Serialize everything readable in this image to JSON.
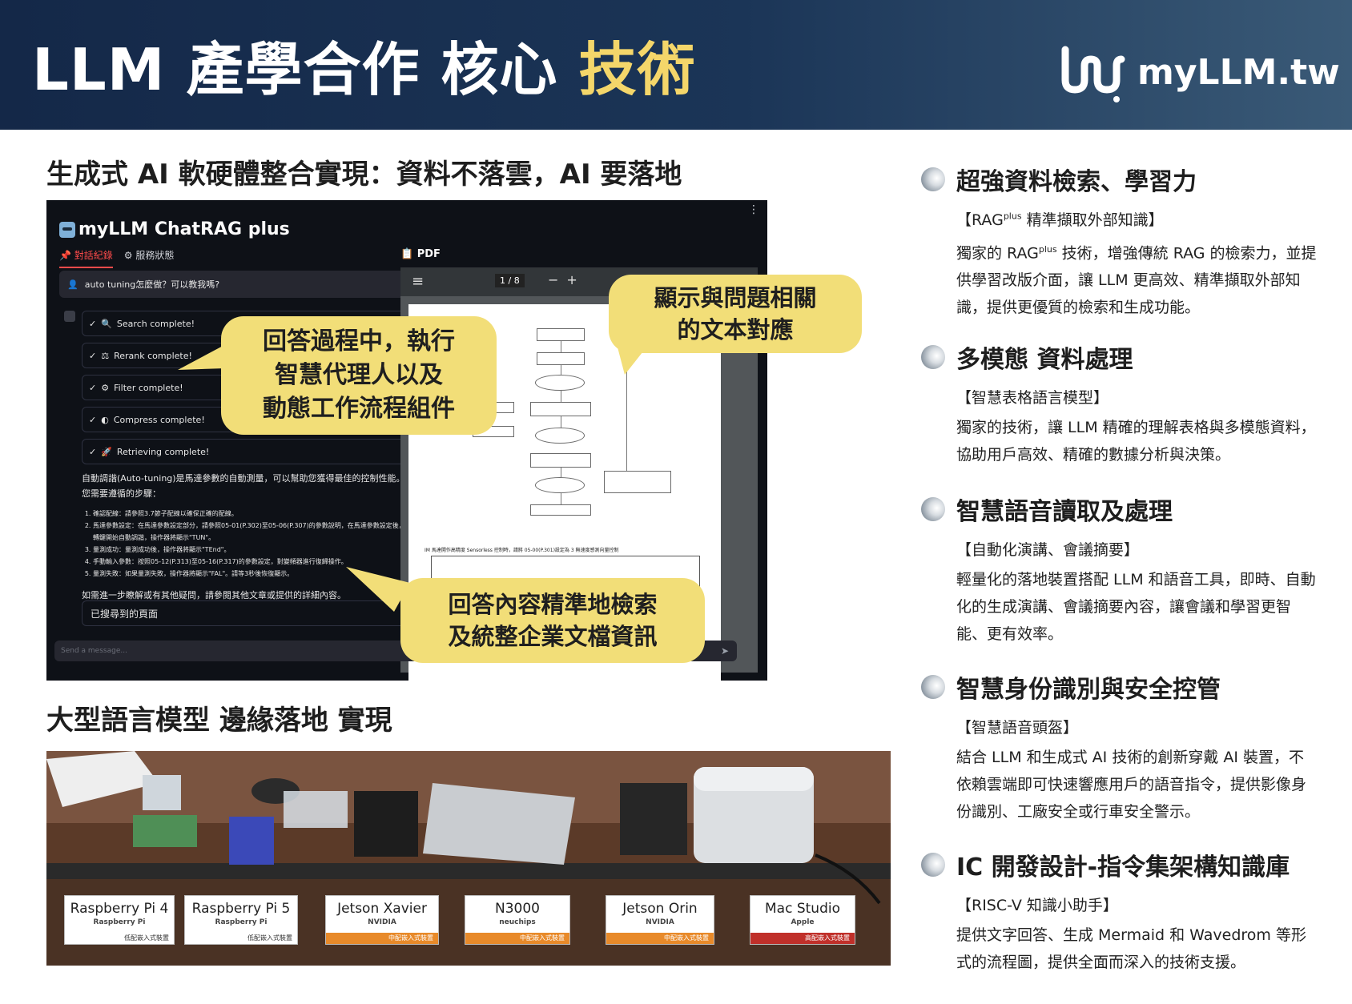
{
  "header": {
    "title_main": "LLM 產學合作 核心 ",
    "title_accent": "技術",
    "logo_text": "myLLM.tw"
  },
  "section1_title": "生成式 AI 軟硬體整合實現：資料不落雲，AI 要落地",
  "section2_title": "大型語言模型 邊緣落地 實現",
  "app": {
    "title": "myLLM ChatRAG plus",
    "tabs": [
      "對話紀錄",
      "服務狀態"
    ],
    "pdf_label": "PDF",
    "user_message": "auto tuning怎麼做？可以教我嗎?",
    "statuses": [
      "Search complete!",
      "Rerank complete!",
      "Filter complete!",
      "Compress complete!",
      "Retrieving complete!"
    ],
    "answer_intro": "自動調諧(Auto-tuning)是馬達參數的自動測量，可以幫助您獲得最佳的控制性能。以下是您需要遵循的步驟：",
    "answer_steps": [
      "確認配線：請參照3.7節子配線以確保正確的配線。",
      "馬達參數設定：在馬達參數設定部分，請參照05-01(P.302)至05-06(P.307)的參數說明，在馬達參數設定後，請按正/反轉鍵開始自動調諧，操作器將顯示\"TUN\"。",
      "量測成功：量測成功後，操作器將顯示\"TEnd\"。",
      "手動輸入參數：按照05-12(P.313)至05-16(P.317)的參數設定，對變頻器進行復歸操作。",
      "量測失敗：如果量測失敗，操作器將顯示\"FAL\"。請等3秒後恢復顯示。"
    ],
    "answer_more": "如需進一步瞭解或有其他疑問，請參閱其他文章或提供的詳細內容。",
    "found_pages": "已搜尋到的頁面",
    "input_placeholder": "Send a message...",
    "pdf_page": "1 / 8",
    "pdf_note": "IM 馬達開作高精度 Sensorless 控制時，請將 05-00(P.301)設定為 3 無速度感測向量控制"
  },
  "callouts": {
    "left": [
      "回答過程中，執行",
      "智慧代理人以及",
      "動態工作流程組件"
    ],
    "right": [
      "顯示與問題相關",
      "的文本對應"
    ],
    "bottom": [
      "回答內容精準地檢索",
      "及統整企業文檔資訊"
    ]
  },
  "hardware": [
    {
      "name": "Raspberry Pi 4",
      "brand": "Raspberry Pi",
      "note": "低配嵌入式裝置"
    },
    {
      "name": "Raspberry Pi 5",
      "brand": "Raspberry Pi",
      "note": "低配嵌入式裝置"
    },
    {
      "name": "Jetson Xavier",
      "brand": "NVIDIA",
      "note": "中配嵌入式裝置"
    },
    {
      "name": "N3000",
      "brand": "neuchips",
      "note": "中配嵌入式裝置"
    },
    {
      "name": "Jetson Orin",
      "brand": "NVIDIA",
      "note": "中配嵌入式裝置"
    },
    {
      "name": "Mac Studio",
      "brand": "Apple",
      "note": "高配嵌入式裝置"
    }
  ],
  "features": [
    {
      "title": "超強資料檢索、學習力",
      "sub_pre": "【RAG",
      "sub_sup": "plus",
      "sub_post": " 精準擷取外部知識】",
      "desc_pre": "獨家的 RAG",
      "desc_sup": "plus",
      "desc_post": " 技術，增強傳統 RAG 的檢索力，並提供學習改版介面，讓 LLM 更高效、精準擷取外部知識，提供更優質的檢索和生成功能。"
    },
    {
      "title": "多模態 資料處理",
      "sub": "【智慧表格語言模型】",
      "desc": "獨家的技術，讓 LLM 精確的理解表格與多模態資料，協助用戶高效、精確的數據分析與決策。"
    },
    {
      "title": "智慧語音讀取及處理",
      "sub": "【自動化演講、會議摘要】",
      "desc": "輕量化的落地裝置搭配 LLM 和語音工具，即時、自動化的生成演講、會議摘要內容，讓會議和學習更智能、更有效率。"
    },
    {
      "title": "智慧身份識別與安全控管",
      "sub": "【智慧語音頭盔】",
      "desc": "結合 LLM 和生成式 AI 技術的創新穿戴 AI 裝置，不依賴雲端即可快速響應用戶的語音指令，提供影像身份識別、工廠安全或行車安全警示。"
    },
    {
      "title": "IC 開發設計-指令集架構知識庫",
      "sub": "【RISC-V 知識小助手】",
      "desc": "提供文字回答、生成 Mermaid 和 Wavedrom 等形式的流程圖，提供全面而深入的技術支援。"
    }
  ],
  "colors": {
    "header_dark": "#142848",
    "accent_yellow": "#f4d66a",
    "callout_yellow": "#f2de78",
    "app_bg": "#0e1117"
  }
}
